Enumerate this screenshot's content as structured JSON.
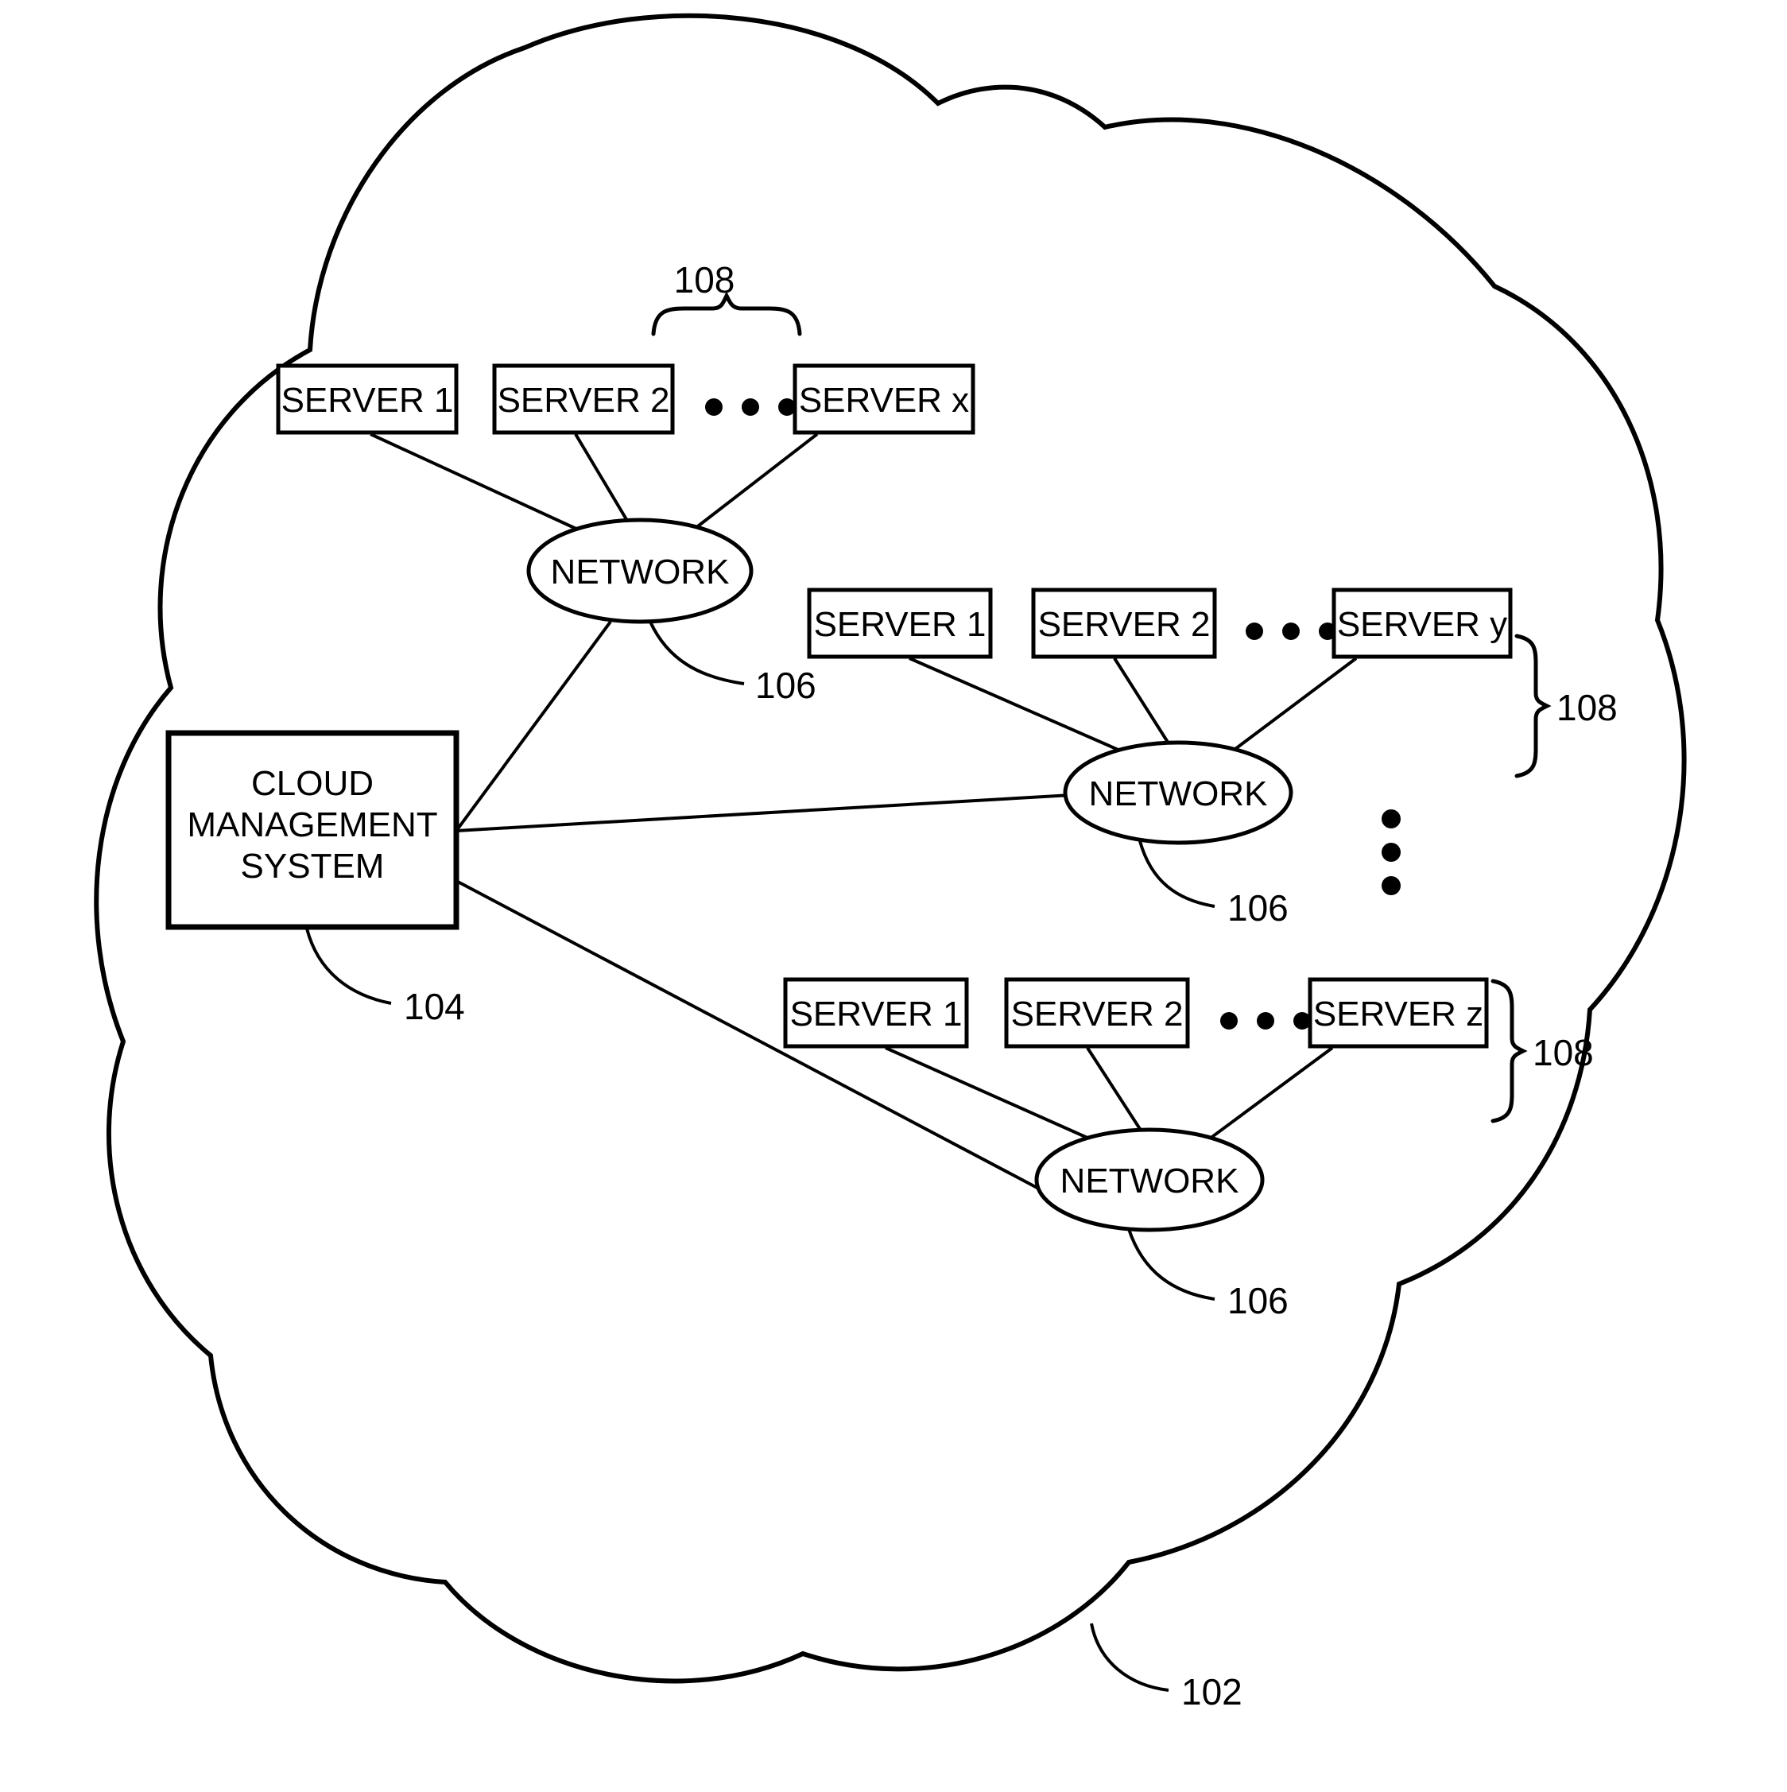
{
  "figure": {
    "type": "patent-diagram",
    "title": "Cloud computing environment block diagram",
    "background_color": "#ffffff",
    "line_color": "#000000"
  },
  "cloud": {
    "name": "cloud-boundary",
    "reference_numeral": "102"
  },
  "cloud_management_system": {
    "line1": "CLOUD",
    "line2": "MANAGEMENT",
    "line3": "SYSTEM",
    "reference_numeral": "104"
  },
  "networks": [
    {
      "label": "NETWORK",
      "reference_numeral": "106"
    },
    {
      "label": "NETWORK",
      "reference_numeral": "106"
    },
    {
      "label": "NETWORK",
      "reference_numeral": "106"
    }
  ],
  "server_groups": [
    {
      "reference_numeral": "108",
      "brace_orientation": "horizontal-top",
      "ellipsis": "• • •",
      "servers": [
        {
          "label": "SERVER 1"
        },
        {
          "label": "SERVER 2"
        },
        {
          "label": "SERVER x"
        }
      ]
    },
    {
      "reference_numeral": "108",
      "brace_orientation": "vertical-right",
      "ellipsis": "• • •",
      "servers": [
        {
          "label": "SERVER 1"
        },
        {
          "label": "SERVER 2"
        },
        {
          "label": "SERVER y"
        }
      ]
    },
    {
      "reference_numeral": "108",
      "brace_orientation": "vertical-right",
      "ellipsis": "• • •",
      "servers": [
        {
          "label": "SERVER 1"
        },
        {
          "label": "SERVER 2"
        },
        {
          "label": "SERVER z"
        }
      ]
    }
  ],
  "vertical_ellipsis": {
    "name": "group-continuation-dots",
    "dots": 3
  }
}
